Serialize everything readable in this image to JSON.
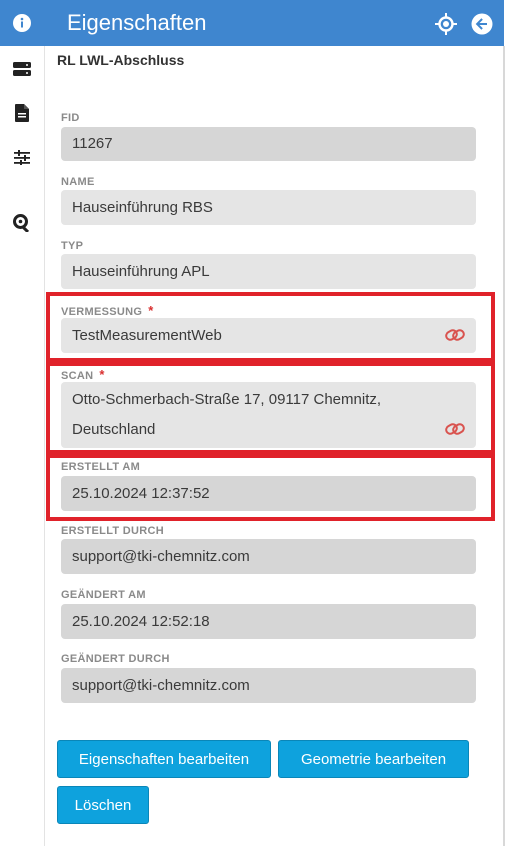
{
  "header": {
    "title": "Eigenschaften"
  },
  "subtitle": "RL LWL-Abschluss",
  "fields": [
    {
      "label": "FID",
      "value": "11267",
      "required": false
    },
    {
      "label": "NAME",
      "value": "Hauseinführung RBS",
      "required": false
    },
    {
      "label": "TYP",
      "value": "Hauseinführung APL",
      "required": false
    },
    {
      "label": "VERMESSUNG",
      "value": "TestMeasurementWeb",
      "required": true,
      "required_mark": "*"
    },
    {
      "label": "SCAN",
      "value_line1": "Otto-Schmerbach-Straße 17, 09117 Chemnitz,",
      "value_line2": "Deutschland",
      "required": true,
      "required_mark": "*"
    },
    {
      "label": "ERSTELLT AM",
      "value": "25.10.2024 12:37:52",
      "required": false
    },
    {
      "label": "ERSTELLT DURCH",
      "value": "support@tki-chemnitz.com",
      "required": false
    },
    {
      "label": "GEÄNDERT AM",
      "value": "25.10.2024 12:52:18",
      "required": false
    },
    {
      "label": "GEÄNDERT DURCH",
      "value": "support@tki-chemnitz.com",
      "required": false
    }
  ],
  "buttons": {
    "edit_properties": "Eigenschaften bearbeiten",
    "edit_geometry": "Geometrie bearbeiten",
    "delete": "Löschen"
  },
  "icons": {
    "rail": [
      "info-icon",
      "layers-icon",
      "document-icon",
      "tune-icon",
      "search-location-icon"
    ],
    "header": [
      "locate-icon",
      "back-arrow-icon"
    ],
    "field_link": "link-icon"
  },
  "colors": {
    "primary": "#3f86cf",
    "button": "#0ea2dd",
    "highlight": "#e0222a",
    "link": "#d9534f"
  }
}
